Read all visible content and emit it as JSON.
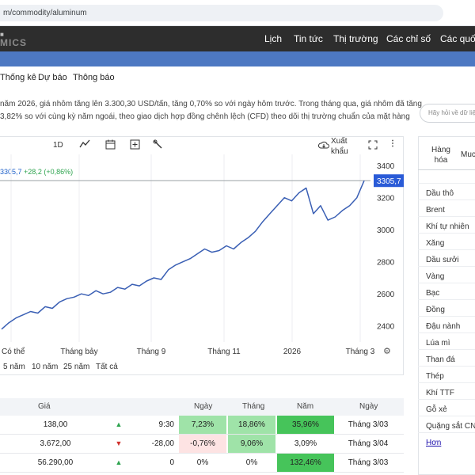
{
  "browser": {
    "url": "m/commodity/aluminum"
  },
  "brand": {
    "text": "MICS"
  },
  "nav": {
    "items": [
      "Lịch",
      "Tin tức",
      "Thị trường",
      "Các chỉ số",
      "Các quốc"
    ]
  },
  "subnav": {
    "items": [
      "Thống kê",
      "Dự báo",
      "Thông báo"
    ]
  },
  "description": {
    "line1": "năm 2026, giá nhôm tăng lên 3.300,30 USD/tấn, tăng 0,70% so với ngày hôm trước. Trong tháng qua, giá nhôm đã tăng",
    "line2": "3,82% so với cùng kỳ năm ngoái, theo giao dịch hợp đồng chênh lệch (CFD) theo dõi thị trường chuẩn của mặt hàng"
  },
  "ask": {
    "placeholder": "Hãy hỏi về dữ liệ"
  },
  "toolbar": {
    "range_1d": "1D",
    "export": "Xuất khẩu"
  },
  "price_change": {
    "price": "3305,7",
    "change": "+28,2 (+0,86%)"
  },
  "chart_data": {
    "type": "line",
    "y_ticks": [
      "3400",
      "3200",
      "3000",
      "2800",
      "2600",
      "2400"
    ],
    "ylim": [
      2300,
      3470
    ],
    "x_ticks": [
      "Có thể",
      "Tháng bảy",
      "Tháng 9",
      "Tháng 11",
      "2026",
      "Tháng 3"
    ],
    "current_label": "3305,7",
    "series": [
      {
        "color": "#3a5fb4",
        "values": [
          2380,
          2420,
          2450,
          2470,
          2490,
          2480,
          2520,
          2510,
          2550,
          2570,
          2580,
          2600,
          2590,
          2620,
          2600,
          2610,
          2640,
          2630,
          2660,
          2650,
          2680,
          2700,
          2690,
          2750,
          2780,
          2800,
          2820,
          2850,
          2880,
          2860,
          2870,
          2900,
          2880,
          2920,
          2950,
          2990,
          3050,
          3100,
          3150,
          3200,
          3180,
          3230,
          3260,
          3100,
          3150,
          3060,
          3080,
          3120,
          3150,
          3200,
          3306
        ]
      }
    ]
  },
  "periods": {
    "items": [
      "5 năm",
      "10 năm",
      "25 năm",
      "Tất cả"
    ]
  },
  "right_panel": {
    "tabs": [
      "Hàng hóa",
      "Muc"
    ],
    "items": [
      "Dầu thô",
      "Brent",
      "Khí tự nhiên",
      "Xăng",
      "Dầu sưởi",
      "Vàng",
      "Bạc",
      "Đồng",
      "Đậu nành",
      "Lúa mì",
      "Than đá",
      "Thép",
      "Khí TTF",
      "Gỗ xẻ",
      "Quặng sắt CNY",
      "Hơn"
    ]
  },
  "table": {
    "headers": [
      "Giá",
      "Ngày",
      "Tháng",
      "Năm",
      "Ngày"
    ],
    "rows": [
      {
        "price": "138,00",
        "dir": "up",
        "change": "9:30",
        "day": "7,23%",
        "month": "18,86%",
        "year": "35,96%",
        "date": "Tháng 3/03"
      },
      {
        "price": "3.672,00",
        "dir": "down",
        "change": "-28,00",
        "day": "-0,76%",
        "month": "9,06%",
        "year": "3,09%",
        "date": "Tháng 3/04"
      },
      {
        "price": "56.290,00",
        "dir": "up",
        "change": "0",
        "day": "0%",
        "month": "0%",
        "year": "132,46%",
        "date": "Tháng 3/03"
      }
    ]
  }
}
